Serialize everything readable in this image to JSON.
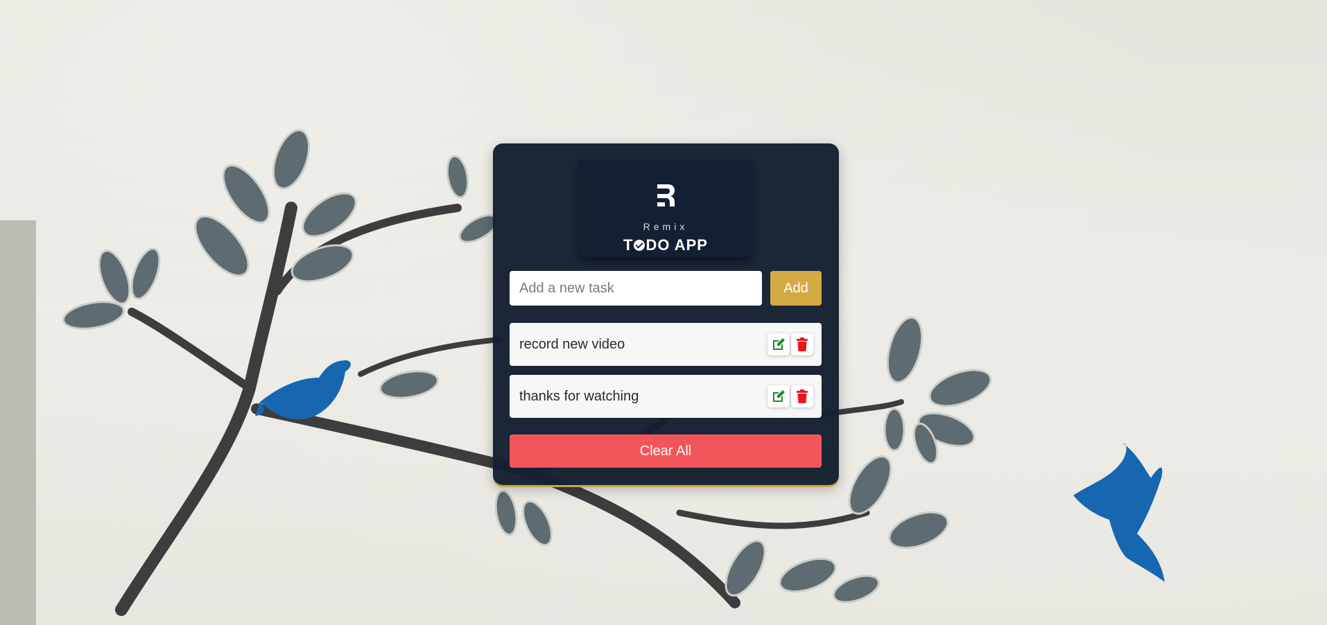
{
  "logo": {
    "icon": "remix-logo-icon",
    "brand": "Remix",
    "title_before": "T",
    "title_after": "DO APP"
  },
  "form": {
    "placeholder": "Add a new task",
    "value": "",
    "add_label": "Add"
  },
  "tasks": [
    {
      "text": "record new video",
      "edit_icon": "edit-icon",
      "delete_icon": "trash-icon"
    },
    {
      "text": "thanks for watching",
      "edit_icon": "edit-icon",
      "delete_icon": "trash-icon"
    }
  ],
  "clear_label": "Clear All",
  "colors": {
    "card": "#141f30",
    "accent": "#d4aa45",
    "danger": "#f25559",
    "edit": "#1a8a2e",
    "delete": "#e8171c"
  }
}
